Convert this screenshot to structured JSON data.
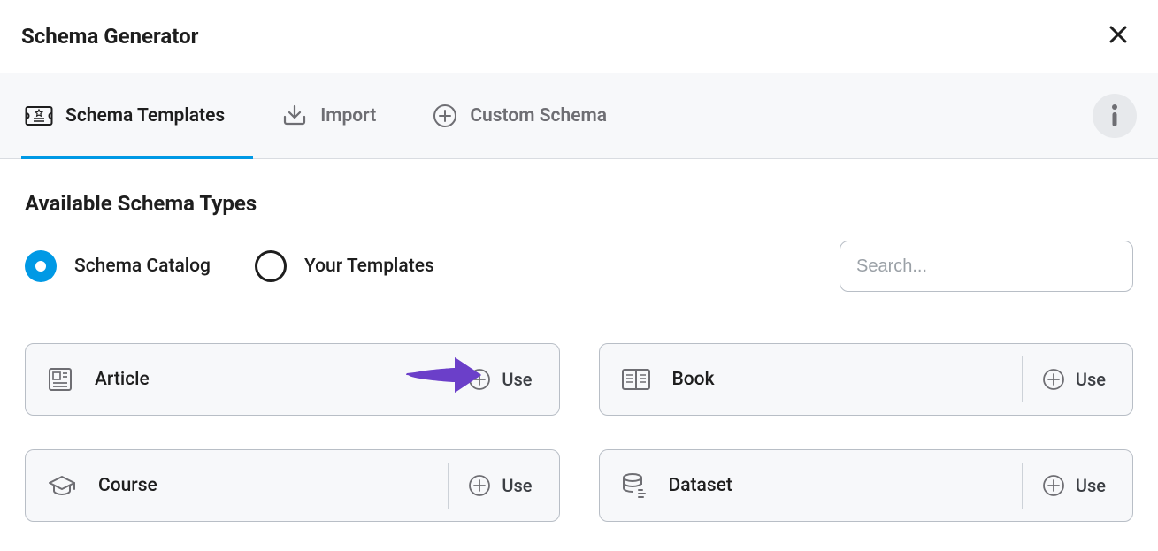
{
  "header": {
    "title": "Schema Generator"
  },
  "tabs": {
    "templates": "Schema Templates",
    "import": "Import",
    "custom": "Custom Schema"
  },
  "section": {
    "title": "Available Schema Types",
    "radios": {
      "catalog": "Schema Catalog",
      "yours": "Your Templates"
    },
    "search_placeholder": "Search..."
  },
  "cards": [
    {
      "name": "Article",
      "use": "Use"
    },
    {
      "name": "Book",
      "use": "Use"
    },
    {
      "name": "Course",
      "use": "Use"
    },
    {
      "name": "Dataset",
      "use": "Use"
    }
  ],
  "use_small_label": "Use"
}
